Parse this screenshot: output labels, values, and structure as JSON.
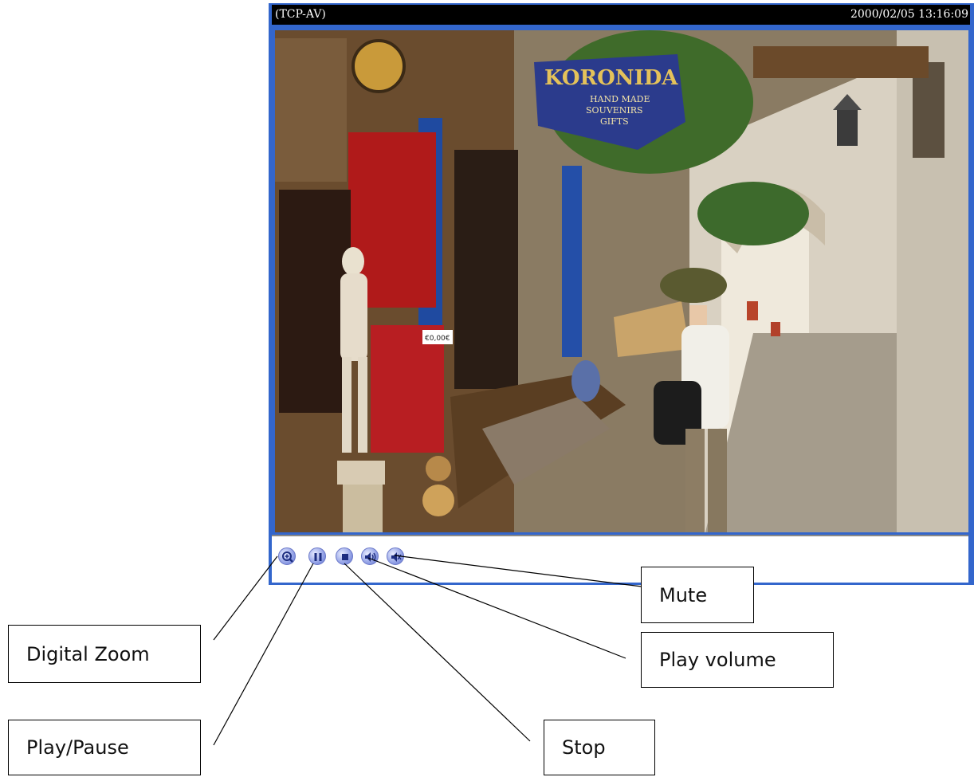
{
  "viewer": {
    "title": "(TCP-AV)",
    "timestamp": "2000/02/05 13:16:09",
    "video_sign": {
      "line1": "KORONIDA",
      "line2": "HAND MADE",
      "line3": "SOUVENIRS",
      "line4": "GIFTS"
    },
    "price_tag": "€0,00€"
  },
  "controls": [
    {
      "name": "digital-zoom-button",
      "icon": "magnifier-plus-icon"
    },
    {
      "name": "play-pause-button",
      "icon": "pause-icon"
    },
    {
      "name": "stop-button",
      "icon": "stop-icon"
    },
    {
      "name": "play-volume-button",
      "icon": "speaker-volume-icon"
    },
    {
      "name": "mute-button",
      "icon": "speaker-mute-icon"
    }
  ],
  "callouts": {
    "digital_zoom": "Digital Zoom",
    "play_pause": "Play/Pause",
    "stop": "Stop",
    "play_volume": "Play volume",
    "mute": "Mute"
  },
  "colors": {
    "frame": "#3366cc",
    "title_bar": "#000000",
    "button": "#7f8fe0"
  }
}
